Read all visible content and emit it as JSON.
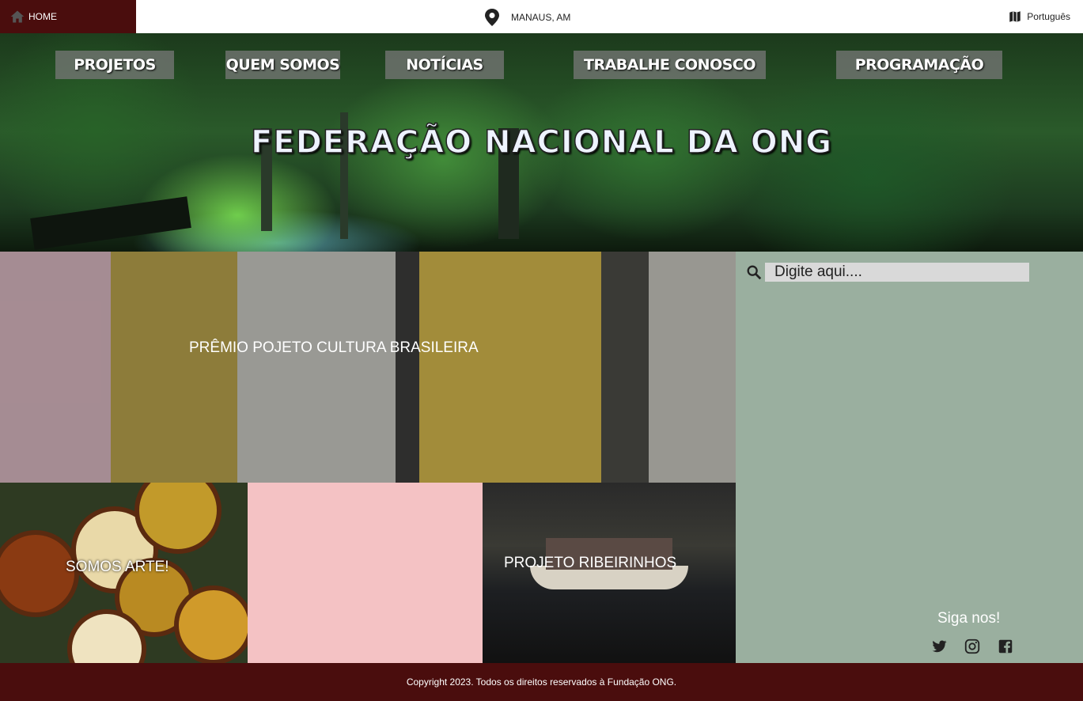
{
  "topbar": {
    "home_label": "HOME",
    "location_label": "MANAUS, AM",
    "language_label": "Português"
  },
  "nav": [
    "PROJETOS",
    "QUEM SOMOS",
    "NOTÍCIAS",
    "TRABALHE CONOSCO",
    "PROGRAMAÇÃO"
  ],
  "hero": {
    "title": "FEDERAÇÃO NACIONAL DA ONG"
  },
  "tiles": {
    "culture": "PRÊMIO POJETO CULTURA BRASILEIRA",
    "arte": "SOMOS ARTE!",
    "ribeirinhos": "PROJETO RIBEIRINHOS"
  },
  "sidebar": {
    "search_placeholder": "Digite aqui....",
    "follow_label": "Siga nos!",
    "social_icons": [
      "twitter-icon",
      "instagram-icon",
      "facebook-icon"
    ]
  },
  "footer": {
    "copyright": "Copyright 2023. Todos os direitos reservados à Fundação  ONG."
  },
  "colors": {
    "brand_dark": "#4a0d0d",
    "sidebar_bg": "#9aaf9f",
    "pink_tile": "#f4c2c4"
  }
}
